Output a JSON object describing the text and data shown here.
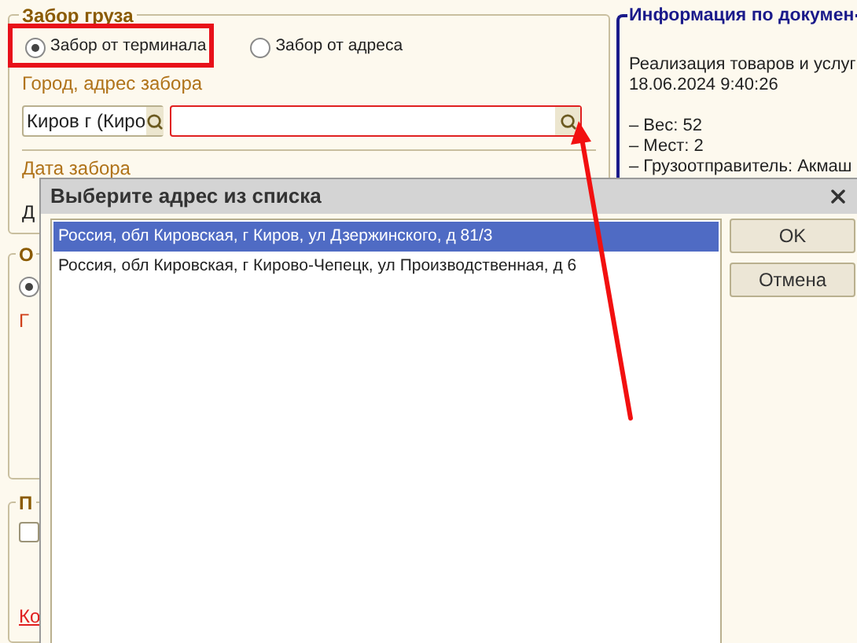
{
  "pickup": {
    "legend": "Забор груза",
    "options": [
      {
        "label": "Забор от терминала",
        "selected": true
      },
      {
        "label": "Забор от адреса",
        "selected": false
      }
    ],
    "address_label": "Город, адрес забора",
    "city_value": "Киров г (Киро",
    "date_label": "Дата забора",
    "date_value": "Д"
  },
  "group_2": {
    "legend": "О",
    "radio_selected": true,
    "label": "Г"
  },
  "group_3": {
    "legend": "П",
    "checked": false,
    "link": "Ко"
  },
  "info": {
    "title": "Информация по докумен",
    "document": [
      "Реализация товаров и услуг",
      "18.06.2024 9:40:26"
    ],
    "details": [
      "– Вес: 52",
      "– Мест: 2",
      "– Грузоотправитель: Акмаш"
    ]
  },
  "dialog": {
    "title": "Выберите адрес из списка",
    "items": [
      {
        "text": "Россия, обл Кировская, г Киров, ул Дзержинского, д 81/3",
        "selected": true
      },
      {
        "text": "Россия, обл Кировская, г Кирово-Чепецк, ул Производственная, д 6",
        "selected": false
      }
    ],
    "buttons": [
      "OK",
      "Отмена"
    ]
  }
}
